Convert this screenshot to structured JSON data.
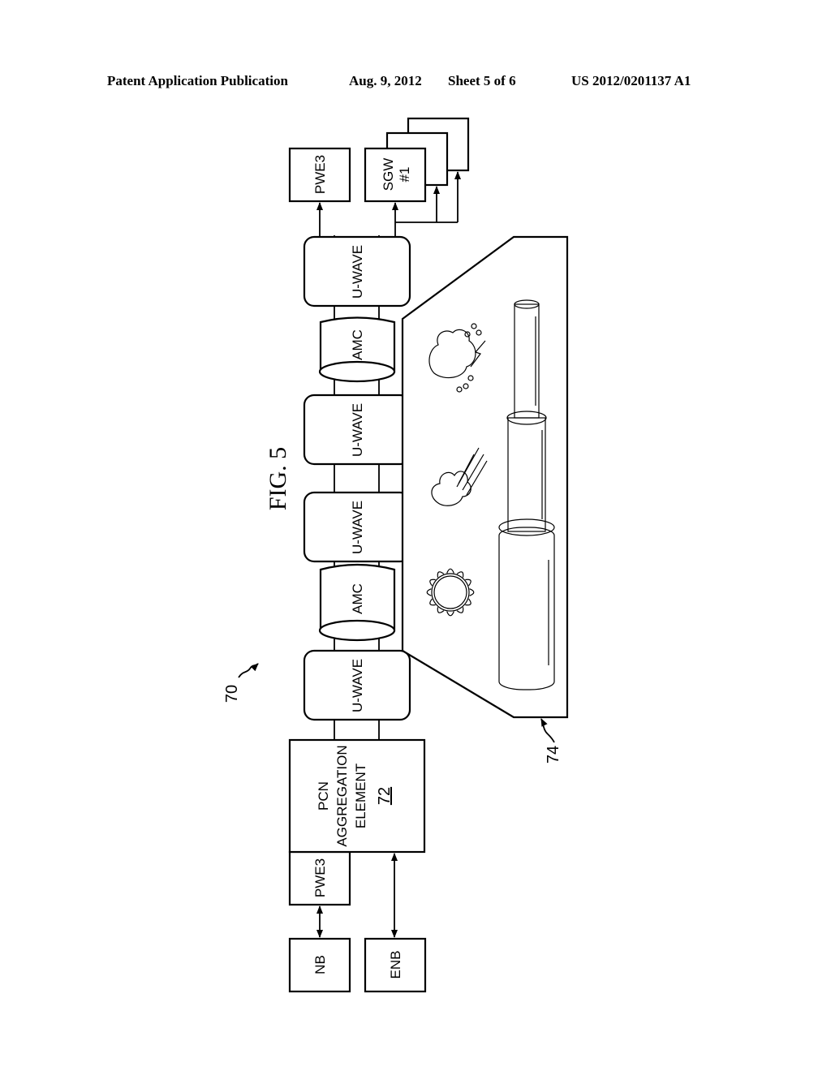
{
  "header": {
    "publication": "Patent Application Publication",
    "date": "Aug. 9, 2012",
    "sheet": "Sheet 5 of 6",
    "number": "US 2012/0201137 A1"
  },
  "figure": {
    "title": "FIG. 5",
    "ref_system": "70",
    "ref_conditions": "74",
    "left_nodes": {
      "nb": "NB",
      "enb": "ENB",
      "pwe3_in": "PWE3"
    },
    "aggregation": {
      "line1": "PCN",
      "line2": "AGGREGATION",
      "line3": "ELEMENT",
      "ref": "72"
    },
    "chain": [
      "U-WAVE",
      "AMC",
      "U-WAVE",
      "U-WAVE",
      "AMC",
      "U-WAVE"
    ],
    "right_nodes": {
      "pwe3_out": "PWE3",
      "sgw_line1": "SGW",
      "sgw_line2": "#1"
    },
    "weather_icons": [
      "sun-icon",
      "rain-cloud-icon",
      "storm-cloud-icon"
    ]
  }
}
